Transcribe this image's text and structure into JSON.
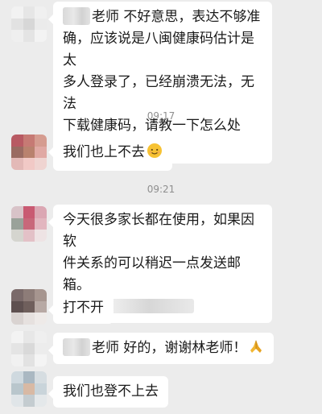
{
  "messages": [
    {
      "name_prefix_blurred": true,
      "lines": [
        "老师  不好意思，表达不够准",
        "确，应该说是八闽健康码估计是太",
        "多人登录了，已经崩溃无法，无法",
        "下载健康码，请教一下怎么处理？"
      ]
    },
    {
      "text": "我们也上不去",
      "emoji": "smiling-face-emoji"
    },
    {
      "lines": [
        "今天很多家长都在使用，如果因软",
        "件关系的可以稍迟一点发送邮箱。"
      ],
      "email_prefix": "@",
      "email_blurred": true
    },
    {
      "text": "打不开"
    },
    {
      "name_prefix_blurred": true,
      "text": "老师  好的，谢谢林老师！",
      "emoji": "folded-hands-emoji"
    },
    {
      "text": "我们也登不上去"
    }
  ],
  "timestamps": [
    "09:17",
    "09:21"
  ],
  "colors": {
    "background": "#ececec",
    "bubble": "#ffffff",
    "text": "#1a1a1a",
    "timestamp": "#8f8f8f"
  }
}
